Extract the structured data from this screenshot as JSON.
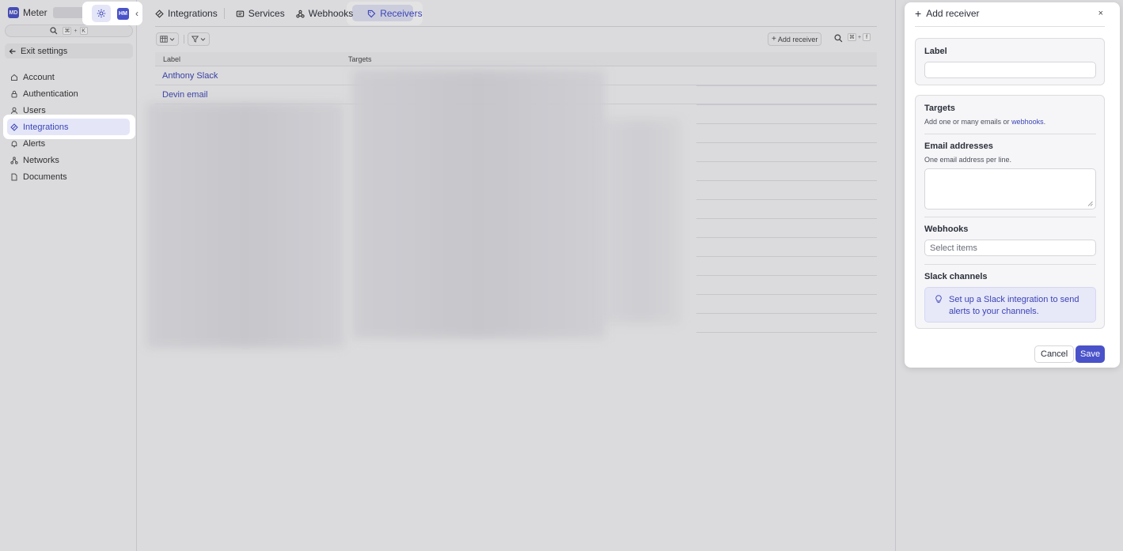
{
  "brand": {
    "logo_text": "MD",
    "name": "Meter"
  },
  "top_controls": {
    "avatar_text": "HM"
  },
  "search": {
    "shortcut_key_1": "⌘",
    "shortcut_plus": "+",
    "shortcut_key_2": "K"
  },
  "sidebar": {
    "exit_label": "Exit settings",
    "items": [
      {
        "label": "Account",
        "icon": "house-icon"
      },
      {
        "label": "Authentication",
        "icon": "lock-icon"
      },
      {
        "label": "Users",
        "icon": "user-icon"
      },
      {
        "label": "Integrations",
        "icon": "integrations-icon",
        "active": true
      },
      {
        "label": "Alerts",
        "icon": "bell-icon"
      },
      {
        "label": "Networks",
        "icon": "network-icon"
      },
      {
        "label": "Documents",
        "icon": "document-icon"
      }
    ]
  },
  "tabs": [
    {
      "label": "Integrations",
      "icon": "integrations-icon"
    },
    {
      "label": "Services",
      "icon": "services-icon"
    },
    {
      "label": "Webhooks",
      "icon": "webhooks-icon"
    },
    {
      "label": "Receivers",
      "icon": "tag-icon",
      "active": true
    }
  ],
  "toolbar": {
    "add_receiver_label": "Add receiver",
    "shortcut_key_1": "⌘",
    "shortcut_plus": "+",
    "shortcut_key_2": "f"
  },
  "table": {
    "columns": [
      "Label",
      "Targets"
    ],
    "rows": [
      {
        "label": "Anthony Slack"
      },
      {
        "label": "Devin email"
      }
    ]
  },
  "drawer": {
    "title": "Add receiver",
    "close_symbol": "×",
    "label_section": {
      "title": "Label",
      "value": ""
    },
    "targets": {
      "title": "Targets",
      "subtitle_prefix": "Add one or many emails or ",
      "subtitle_link": "webhooks",
      "subtitle_suffix": ".",
      "email": {
        "title": "Email addresses",
        "hint": "One email address per line.",
        "value": ""
      },
      "webhooks": {
        "title": "Webhooks",
        "placeholder": "Select items"
      },
      "slack": {
        "title": "Slack channels",
        "callout": "Set up a Slack integration to send alerts to your channels."
      }
    },
    "cancel_label": "Cancel",
    "save_label": "Save"
  },
  "colors": {
    "accent": "#4a52c9",
    "accent_text": "#3b44b6",
    "active_bg": "#e4e6f7"
  }
}
